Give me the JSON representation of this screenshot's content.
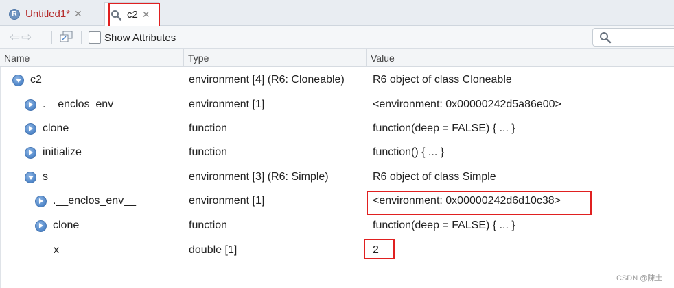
{
  "tabs": [
    {
      "label": "Untitled1*",
      "icon": "r-file-icon"
    },
    {
      "label": "c2",
      "icon": "search-icon"
    }
  ],
  "toolbar": {
    "show_attributes_label": "Show Attributes",
    "show_attributes_checked": false,
    "search_placeholder": ""
  },
  "columns": {
    "name": "Name",
    "type": "Type",
    "value": "Value"
  },
  "rows": [
    {
      "name": "c2",
      "type": "environment [4] (R6: Cloneable)",
      "value": "R6 object of class Cloneable",
      "indent": 0,
      "expander": "expanded"
    },
    {
      "name": ".__enclos_env__",
      "type": "environment [1]",
      "value": "<environment: 0x00000242d5a86e00>",
      "indent": 1,
      "expander": "collapsed"
    },
    {
      "name": "clone",
      "type": "function",
      "value": "function(deep = FALSE) { ... }",
      "indent": 1,
      "expander": "collapsed"
    },
    {
      "name": "initialize",
      "type": "function",
      "value": "function() { ... }",
      "indent": 1,
      "expander": "collapsed"
    },
    {
      "name": "s",
      "type": "environment [3] (R6: Simple)",
      "value": "R6 object of class Simple",
      "indent": 1,
      "expander": "expanded"
    },
    {
      "name": ".__enclos_env__",
      "type": "environment [1]",
      "value": "<environment: 0x00000242d6d10c38>",
      "indent": 2,
      "expander": "collapsed"
    },
    {
      "name": "clone",
      "type": "function",
      "value": "function(deep = FALSE) { ... }",
      "indent": 2,
      "expander": "collapsed"
    },
    {
      "name": "x",
      "type": "double [1]",
      "value": "2",
      "indent": 2,
      "expander": "none"
    }
  ],
  "watermark": "CSDN @陳土",
  "colors": {
    "highlight": "#e02020",
    "unsaved_tab": "#b52a2a",
    "expander": "#4f86c9"
  }
}
